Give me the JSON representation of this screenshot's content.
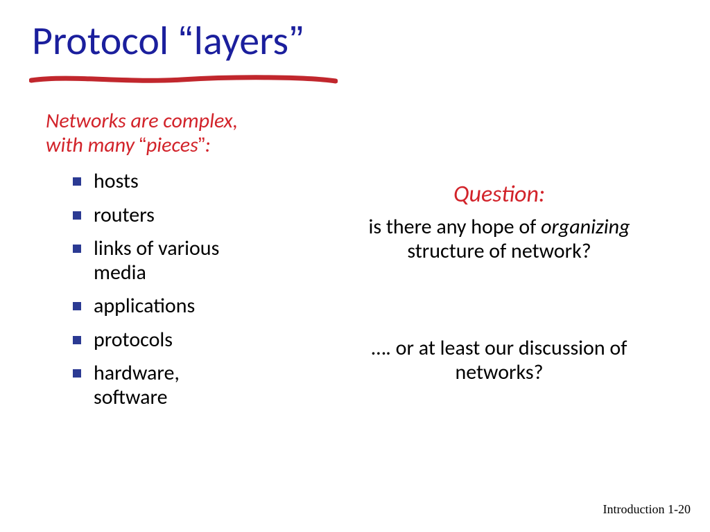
{
  "title": {
    "part1": "Protocol ",
    "quote_open": "“",
    "part2": "layers",
    "quote_close": "”"
  },
  "left": {
    "intro_line1": "Networks are complex,",
    "intro_line2a": "with many ",
    "intro_q_open": "“",
    "intro_line2b": "pieces",
    "intro_q_close": "”",
    "intro_line2c": ":",
    "items": [
      "hosts",
      "routers",
      "links of various media",
      "applications",
      "protocols",
      "hardware, software"
    ]
  },
  "right": {
    "question_label": "Question:",
    "q1a": "is there any hope of ",
    "q1b_italic": "organizing",
    "q1c": " structure of network?",
    "q2": "…. or at least our discussion of networks?"
  },
  "footer": {
    "text": "Introduction 1-20"
  }
}
